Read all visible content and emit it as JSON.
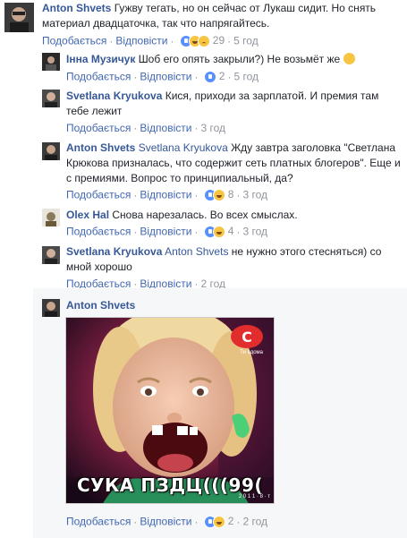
{
  "comments": [
    {
      "author": "Anton Shvets",
      "mention": "",
      "text": "Гужву тегать, но он сейчас от Лукаш сидит. Но снять материал двадцаточка, так что напрягайтесь.",
      "like": "Подобається",
      "reply": "Відповісти",
      "reacts": [
        "like",
        "haha",
        "sad"
      ],
      "count": "29",
      "time": "5 год"
    },
    {
      "author": "Інна Музичук",
      "mention": "",
      "text": "Шоб его опять закрыли?) Не возьмёт же",
      "emoji": "confused",
      "like": "Подобається",
      "reply": "Відповісти",
      "reacts": [
        "like"
      ],
      "count": "2",
      "time": "5 год"
    },
    {
      "author": "Svetlana Kryukova",
      "mention": "",
      "text": "Кися, приходи за зарплатой. И премия там тебе лежит",
      "like": "Подобається",
      "reply": "Відповісти",
      "time": "3 год"
    },
    {
      "author": "Anton Shvets",
      "mention": "Svetlana Kryukova",
      "text": "Жду завтра заголовка \"Светлана Крюкова призналась, что содержит сеть платных блогеров\". Еще и с премиями. Вопрос то принципиальный, да?",
      "like": "Подобається",
      "reply": "Відповісти",
      "reacts": [
        "like",
        "haha"
      ],
      "count": "8",
      "time": "3 год"
    },
    {
      "author": "Olex Hal",
      "mention": "",
      "text": "Снова нарезалась. Во всех смыслах.",
      "like": "Подобається",
      "reply": "Відповісти",
      "reacts": [
        "like",
        "haha"
      ],
      "count": "4",
      "time": "3 год"
    },
    {
      "author": "Svetlana Kryukova",
      "mention": "Anton Shvets",
      "text": "не нужно этого стесняться) со мной хорошо",
      "like": "Подобається",
      "reply": "Відповісти",
      "time": "2 год"
    },
    {
      "author": "Anton Shvets",
      "mention": "",
      "text": "",
      "meme_caption": "СУКА ПЗДЦ(((99(",
      "like": "Подобається",
      "reply": "Відповісти",
      "reacts": [
        "like",
        "haha"
      ],
      "count": "2",
      "time": "2 год"
    }
  ],
  "meme": {
    "channel_logo": "С",
    "channel_slogan": "Ти вдома",
    "watermark": "2 0 1 1 · 8 · т"
  }
}
